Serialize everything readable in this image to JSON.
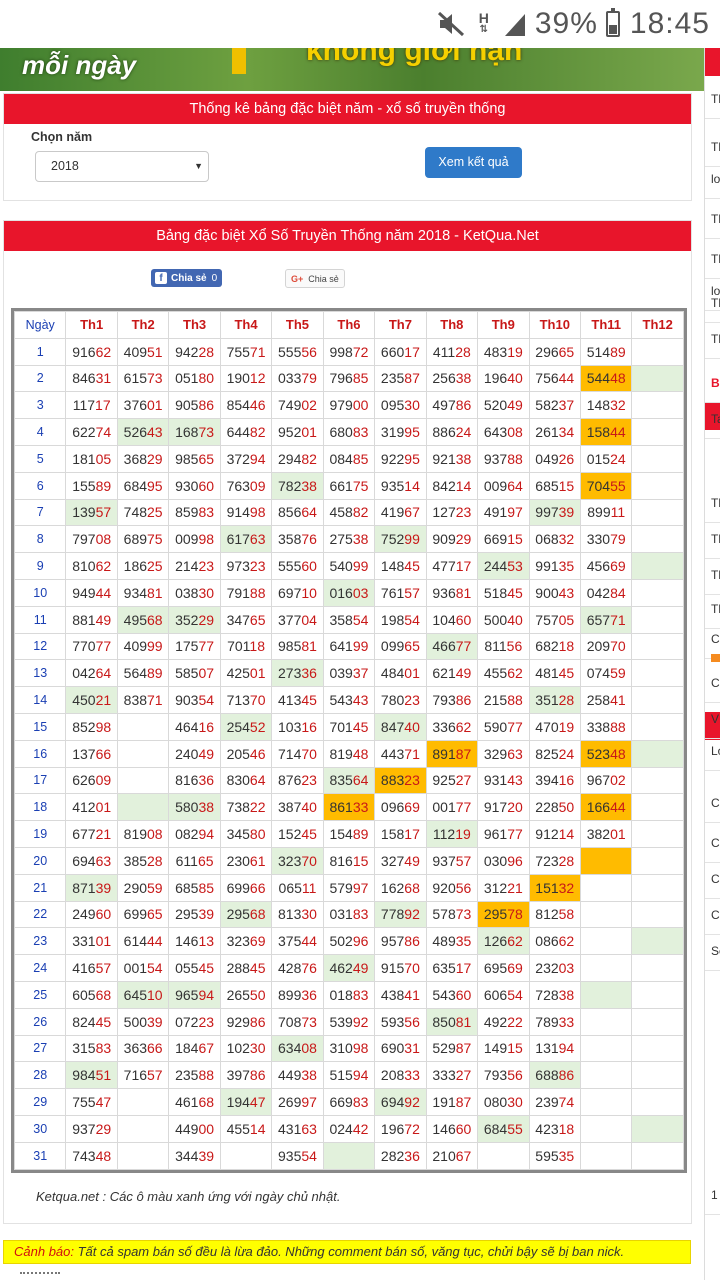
{
  "status": {
    "battery": "39%",
    "time": "18:45",
    "net": "H"
  },
  "banner": {
    "left": "mỗi ngày",
    "right": "không giới hạn"
  },
  "year_section": {
    "title": "Thống kê bảng đặc biệt năm - xổ số truyền thống",
    "label": "Chọn năm",
    "selected": "2018",
    "button": "Xem kết quả"
  },
  "table_section": {
    "title": "Bảng đặc biệt Xổ Số Truyền Thống năm 2018 - KetQua.Net",
    "fb_label": "Chia sẻ",
    "fb_count": "0",
    "gplus_label": "Chia sẻ",
    "headers": [
      "Ngày",
      "Th1",
      "Th2",
      "Th3",
      "Th4",
      "Th5",
      "Th6",
      "Th7",
      "Th8",
      "Th9",
      "Th10",
      "Th11",
      "Th12"
    ],
    "rows": [
      [
        "1",
        "91662",
        "40951",
        "94228",
        "75571",
        "55556",
        "99872",
        "66017",
        "41128",
        "48319",
        "29665",
        "51489",
        ""
      ],
      [
        "2",
        "84631",
        "61573",
        "05180",
        "19012",
        "03379",
        "79685",
        "23587",
        "25638",
        "19640",
        "75644",
        "54448",
        ""
      ],
      [
        "3",
        "11717",
        "37601",
        "90586",
        "85446",
        "74902",
        "97900",
        "09530",
        "49786",
        "52049",
        "58237",
        "14832",
        ""
      ],
      [
        "4",
        "62274",
        "52643",
        "16873",
        "64482",
        "95201",
        "68083",
        "31995",
        "88624",
        "64308",
        "26134",
        "15844",
        ""
      ],
      [
        "5",
        "18105",
        "36829",
        "98565",
        "37294",
        "29482",
        "08485",
        "92295",
        "92138",
        "93788",
        "04926",
        "01524",
        ""
      ],
      [
        "6",
        "15589",
        "68495",
        "93060",
        "76309",
        "78238",
        "66175",
        "93514",
        "84214",
        "00964",
        "68515",
        "70455",
        ""
      ],
      [
        "7",
        "13957",
        "74825",
        "85983",
        "91498",
        "85664",
        "45882",
        "41967",
        "12723",
        "49197",
        "99739",
        "89911",
        ""
      ],
      [
        "8",
        "79708",
        "68975",
        "00998",
        "61763",
        "35876",
        "27538",
        "75299",
        "90929",
        "66915",
        "06832",
        "33079",
        ""
      ],
      [
        "9",
        "81062",
        "18625",
        "21423",
        "97323",
        "55560",
        "54099",
        "14845",
        "47717",
        "24453",
        "99135",
        "45669",
        ""
      ],
      [
        "10",
        "94944",
        "93481",
        "03830",
        "79188",
        "69710",
        "01603",
        "76157",
        "93681",
        "51845",
        "90043",
        "04284",
        ""
      ],
      [
        "11",
        "88149",
        "49568",
        "35229",
        "34765",
        "37704",
        "35854",
        "19854",
        "10460",
        "50040",
        "75705",
        "65771",
        ""
      ],
      [
        "12",
        "77077",
        "40999",
        "17577",
        "70118",
        "98581",
        "64199",
        "09965",
        "46677",
        "81156",
        "68218",
        "20970",
        ""
      ],
      [
        "13",
        "04264",
        "56489",
        "58507",
        "42501",
        "27336",
        "03937",
        "48401",
        "62149",
        "45562",
        "48145",
        "07459",
        ""
      ],
      [
        "14",
        "45021",
        "83871",
        "90354",
        "71370",
        "41345",
        "54343",
        "78023",
        "79386",
        "21588",
        "35128",
        "25841",
        ""
      ],
      [
        "15",
        "85298",
        "",
        "46416",
        "25452",
        "10316",
        "70145",
        "84740",
        "33662",
        "59077",
        "47019",
        "33888",
        ""
      ],
      [
        "16",
        "13766",
        "",
        "24049",
        "20546",
        "71470",
        "81948",
        "44371",
        "89187",
        "32963",
        "82524",
        "52348",
        ""
      ],
      [
        "17",
        "62609",
        "",
        "81636",
        "83064",
        "87623",
        "83564",
        "88323",
        "92527",
        "93143",
        "39416",
        "96702",
        ""
      ],
      [
        "18",
        "41201",
        "",
        "58038",
        "73822",
        "38740",
        "86133",
        "09669",
        "00177",
        "91720",
        "22850",
        "16644",
        ""
      ],
      [
        "19",
        "67721",
        "81908",
        "08294",
        "34580",
        "15245",
        "15489",
        "15817",
        "11219",
        "96177",
        "91214",
        "38201",
        ""
      ],
      [
        "20",
        "69463",
        "38528",
        "61165",
        "23061",
        "32370",
        "81615",
        "32749",
        "93757",
        "03096",
        "72328",
        "",
        ""
      ],
      [
        "21",
        "87139",
        "29059",
        "68585",
        "69966",
        "06511",
        "57997",
        "16268",
        "92056",
        "31221",
        "15132",
        "",
        ""
      ],
      [
        "22",
        "24960",
        "69965",
        "29539",
        "29568",
        "81330",
        "03183",
        "77892",
        "57873",
        "29578",
        "81258",
        "",
        ""
      ],
      [
        "23",
        "33101",
        "61444",
        "14613",
        "32369",
        "37544",
        "50296",
        "95786",
        "48935",
        "12662",
        "08662",
        "",
        ""
      ],
      [
        "24",
        "41657",
        "00154",
        "05545",
        "28845",
        "42876",
        "46249",
        "91570",
        "63517",
        "69569",
        "23203",
        "",
        ""
      ],
      [
        "25",
        "60568",
        "64510",
        "96594",
        "26550",
        "89936",
        "01883",
        "43841",
        "54360",
        "60654",
        "72838",
        "",
        ""
      ],
      [
        "26",
        "82445",
        "50039",
        "07223",
        "92986",
        "70873",
        "53992",
        "59356",
        "85081",
        "49222",
        "78933",
        "",
        ""
      ],
      [
        "27",
        "31583",
        "36366",
        "18467",
        "10230",
        "63408",
        "31098",
        "69031",
        "52987",
        "14915",
        "13194",
        "",
        ""
      ],
      [
        "28",
        "98451",
        "71657",
        "23588",
        "39786",
        "44938",
        "51594",
        "20833",
        "33327",
        "79356",
        "68886",
        "",
        ""
      ],
      [
        "29",
        "75547",
        "",
        "46168",
        "19447",
        "26997",
        "66983",
        "69492",
        "19187",
        "08030",
        "23974",
        "",
        ""
      ],
      [
        "30",
        "93729",
        "",
        "44900",
        "45514",
        "43163",
        "02442",
        "19672",
        "14660",
        "68455",
        "42318",
        "",
        ""
      ],
      [
        "31",
        "74348",
        "",
        "34439",
        "",
        "93554",
        "",
        "28236",
        "21067",
        "",
        "59535",
        "",
        ""
      ]
    ],
    "green": [
      [
        2,
        12
      ],
      [
        4,
        2
      ],
      [
        4,
        3
      ],
      [
        6,
        5
      ],
      [
        7,
        1
      ],
      [
        7,
        10
      ],
      [
        8,
        4
      ],
      [
        8,
        7
      ],
      [
        9,
        9
      ],
      [
        9,
        12
      ],
      [
        10,
        6
      ],
      [
        11,
        2
      ],
      [
        11,
        3
      ],
      [
        11,
        11
      ],
      [
        12,
        8
      ],
      [
        13,
        5
      ],
      [
        14,
        1
      ],
      [
        14,
        10
      ],
      [
        15,
        4
      ],
      [
        15,
        7
      ],
      [
        16,
        12
      ],
      [
        17,
        6
      ],
      [
        18,
        2
      ],
      [
        18,
        3
      ],
      [
        19,
        8
      ],
      [
        20,
        5
      ],
      [
        21,
        1
      ],
      [
        22,
        4
      ],
      [
        22,
        7
      ],
      [
        23,
        9
      ],
      [
        23,
        12
      ],
      [
        24,
        6
      ],
      [
        25,
        2
      ],
      [
        25,
        3
      ],
      [
        25,
        11
      ],
      [
        26,
        8
      ],
      [
        27,
        5
      ],
      [
        28,
        1
      ],
      [
        28,
        10
      ],
      [
        29,
        4
      ],
      [
        29,
        7
      ],
      [
        30,
        9
      ],
      [
        30,
        12
      ],
      [
        31,
        6
      ]
    ],
    "orange": [
      [
        2,
        11
      ],
      [
        4,
        11
      ],
      [
        6,
        11
      ],
      [
        16,
        8
      ],
      [
        16,
        11
      ],
      [
        17,
        7
      ],
      [
        18,
        6
      ],
      [
        18,
        11
      ],
      [
        20,
        11
      ],
      [
        21,
        10
      ],
      [
        22,
        9
      ]
    ],
    "footnote": "Ketqua.net : Các ô màu xanh ứng với ngày chủ nhật."
  },
  "warning": {
    "label": "Cảnh báo:",
    "text": " Tất cả spam bán số đều là lừa đảo. Những comment bán số, văng tục, chửi bậy sẽ bị ban nick."
  },
  "sidebar": {
    "items": [
      "Th",
      "Th",
      "lo",
      "Th",
      "Th",
      "lo",
      "Th",
      "Th",
      "Ba",
      "Ta",
      "Th",
      "Th",
      "Th",
      "Th",
      "Cá",
      "Cá",
      "V",
      "Lo",
      "Cl",
      "Cl",
      "Cl",
      "Cl",
      "Sc",
      "1"
    ]
  },
  "colors": {
    "accent_red": "#e8152b",
    "button_blue": "#2f7ac9",
    "sunday_green": "#e2f1dc",
    "highlight_orange": "#ffbb00",
    "warning_yellow": "#ffff00"
  }
}
